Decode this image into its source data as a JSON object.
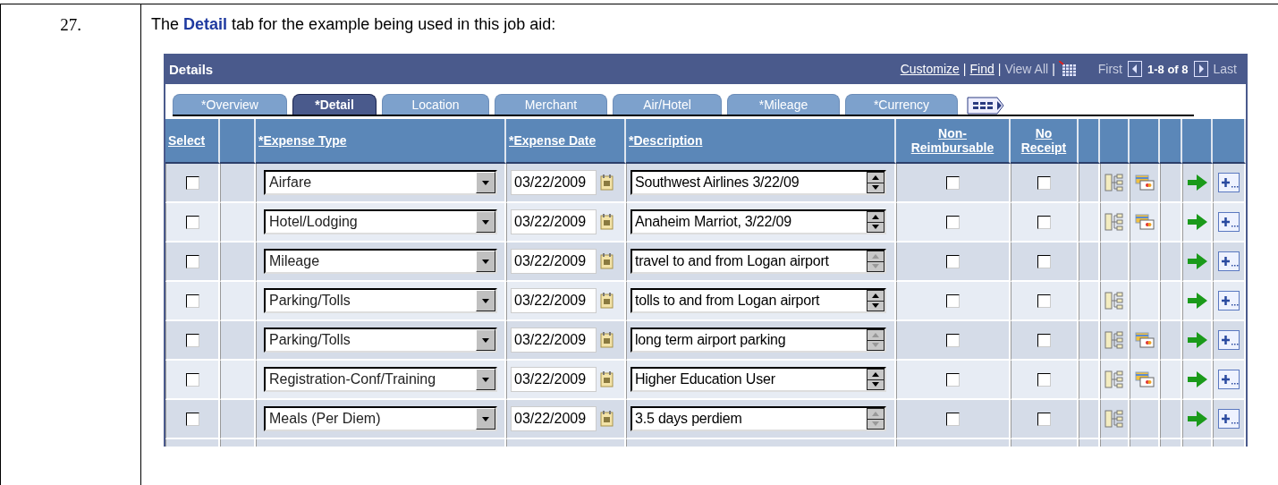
{
  "step": {
    "number": "27.",
    "text": "The **Detail** tab for the example being used in this job aid:"
  },
  "grid": {
    "title": "Details",
    "links": [
      {
        "label": "Customize",
        "disabled": false,
        "separator": "|"
      },
      {
        "label": "Find",
        "disabled": false,
        "separator": "|"
      },
      {
        "label": "View All",
        "disabled": true,
        "separator": "|"
      }
    ],
    "pager": {
      "first": "First",
      "range": "1-8 of 8",
      "last": "Last"
    },
    "tabs": [
      {
        "label": "*Overview",
        "selected": false
      },
      {
        "label": "*Detail",
        "selected": true
      },
      {
        "label": "Location",
        "selected": false
      },
      {
        "label": "Merchant",
        "selected": false
      },
      {
        "label": "Air/Hotel",
        "selected": false
      },
      {
        "label": "*Mileage",
        "selected": false
      },
      {
        "label": "*Currency",
        "selected": false
      }
    ],
    "columns": [
      "Select",
      "*Expense Type",
      "*Expense Date",
      "*Description",
      "Non-Reimbursable",
      "No Receipt"
    ],
    "rows": [
      {
        "selected": false,
        "expense_type": "Airfare",
        "date": "03/22/2009",
        "description": "Southwest Airlines 3/22/09",
        "spinner_enabled": true,
        "non_reimbursable": false,
        "no_receipt": false,
        "distribution": true,
        "card": true
      },
      {
        "selected": false,
        "expense_type": "Hotel/Lodging",
        "date": "03/22/2009",
        "description": "Anaheim Marriot, 3/22/09",
        "spinner_enabled": true,
        "non_reimbursable": false,
        "no_receipt": false,
        "distribution": true,
        "card": true
      },
      {
        "selected": false,
        "expense_type": "Mileage",
        "date": "03/22/2009",
        "description": "travel to and from Logan airport",
        "spinner_enabled": false,
        "non_reimbursable": false,
        "no_receipt": false,
        "distribution": false,
        "card": false
      },
      {
        "selected": false,
        "expense_type": "Parking/Tolls",
        "date": "03/22/2009",
        "description": "tolls to and from Logan airport",
        "spinner_enabled": true,
        "non_reimbursable": false,
        "no_receipt": false,
        "distribution": true,
        "card": false
      },
      {
        "selected": false,
        "expense_type": "Parking/Tolls",
        "date": "03/22/2009",
        "description": "long term airport parking",
        "spinner_enabled": false,
        "non_reimbursable": false,
        "no_receipt": false,
        "distribution": true,
        "card": true
      },
      {
        "selected": false,
        "expense_type": "Registration-Conf/Training",
        "date": "03/22/2009",
        "description": "Higher Education User",
        "spinner_enabled": true,
        "non_reimbursable": false,
        "no_receipt": false,
        "distribution": true,
        "card": true
      },
      {
        "selected": false,
        "expense_type": "Meals (Per Diem)",
        "date": "03/22/2009",
        "description": "3.5 days perdiem",
        "spinner_enabled": false,
        "non_reimbursable": false,
        "no_receipt": false,
        "distribution": true,
        "card": false
      }
    ]
  }
}
